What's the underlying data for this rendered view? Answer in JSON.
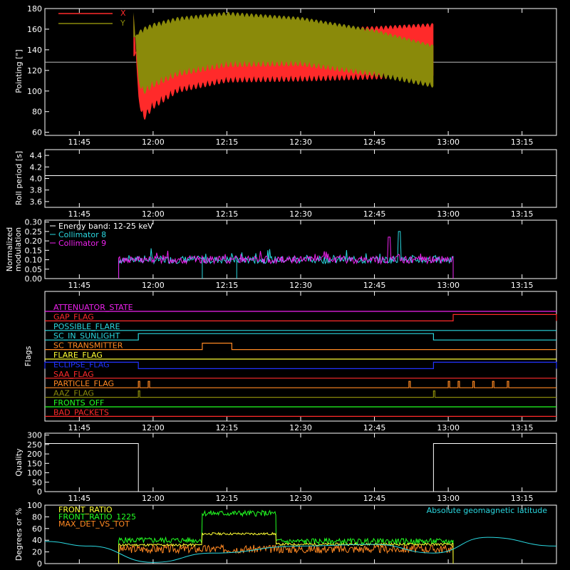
{
  "time_ticks": [
    "11:45",
    "12:00",
    "12:15",
    "12:30",
    "12:45",
    "13:00",
    "13:15"
  ],
  "colors": {
    "axis": "#ffffff",
    "red": "#ff2a2a",
    "olive": "#8a8a0a",
    "cyan": "#2ad8e0",
    "magenta": "#ee22ee",
    "yellow": "#ffff33",
    "green": "#22ff22",
    "orange": "#ff8822",
    "blue": "#2233ff"
  },
  "panels": {
    "pointing": {
      "ylabel": "Pointing [\"]",
      "yticks": [
        "180",
        "160",
        "140",
        "120",
        "100",
        "80",
        "60"
      ],
      "legend": [
        "X",
        "Y"
      ]
    },
    "roll": {
      "ylabel": "Roll period [s]",
      "yticks": [
        "4.4",
        "4.2",
        "4.0",
        "3.8",
        "3.6"
      ]
    },
    "modulation": {
      "ylabel_line1": "Normalized",
      "ylabel_line2": "modulation",
      "yticks": [
        "0.30",
        "0.25",
        "0.20",
        "0.15",
        "0.10",
        "0.05",
        "0.00"
      ],
      "legend": [
        "Energy band: 12-25 keV",
        "Collimator 8",
        "Collimator 9"
      ]
    },
    "flags": {
      "ylabel": "Flags",
      "names": [
        "ATTENUATOR_STATE",
        "GAP_FLAG",
        "POSSIBLE_FLARE",
        "SC_IN_SUNLIGHT",
        "SC_TRANSMITTER",
        "FLARE_FLAG",
        "ECLIPSE_FLAG",
        "SAA_FLAG",
        "PARTICLE_FLAG",
        "AAZ_FLAG",
        "FRONTS_OFF",
        "BAD_PACKETS"
      ]
    },
    "quality": {
      "ylabel": "Quality",
      "yticks": [
        "300",
        "250",
        "200",
        "150",
        "100",
        "50",
        "0"
      ]
    },
    "latitude": {
      "ylabel": "Degrees or %",
      "yticks": [
        "100",
        "80",
        "60",
        "40",
        "20",
        "0"
      ],
      "legend": [
        "FRONT_RATIO",
        "FRONT_RATIO_1225",
        "MAX_DET_VS_TOT"
      ],
      "legend_right": "Absolute geomagnetic latitude"
    }
  },
  "chart_data": [
    {
      "type": "line",
      "title": "",
      "ylabel": "Pointing [\"]",
      "ylim": [
        57,
        180
      ],
      "xlim": [
        "11:38",
        "13:22"
      ],
      "series": [
        {
          "name": "X",
          "x": [
            "11:56",
            "11:57",
            "11:58",
            "12:00",
            "12:05",
            "12:15",
            "12:30",
            "12:45",
            "12:57"
          ],
          "envelope_low": [
            180,
            90,
            70,
            82,
            98,
            108,
            109,
            111,
            113
          ],
          "envelope_high": [
            130,
            145,
            150,
            152,
            156,
            158,
            161,
            163,
            166
          ]
        },
        {
          "name": "Y",
          "x": [
            "11:56",
            "11:57",
            "11:58",
            "12:00",
            "12:05",
            "12:15",
            "12:30",
            "12:45",
            "12:57"
          ],
          "envelope_low": [
            180,
            108,
            96,
            103,
            114,
            123,
            124,
            114,
            103
          ],
          "envelope_high": [
            150,
            158,
            162,
            166,
            172,
            177,
            172,
            160,
            145
          ]
        }
      ],
      "reference_y": 128
    },
    {
      "type": "line",
      "ylabel": "Roll period [s]",
      "ylim": [
        3.5,
        4.5
      ],
      "series": [
        {
          "name": "",
          "x": [
            "11:38",
            "13:22"
          ],
          "y": [
            4.05,
            4.05
          ]
        }
      ]
    },
    {
      "type": "line",
      "ylabel": "Normalized modulation",
      "ylim": [
        0.0,
        0.31
      ],
      "series": [
        {
          "name": "Collimator 8",
          "x_range": [
            "11:53",
            "13:01"
          ],
          "baseline": 0.1,
          "peak": {
            "x": "12:50",
            "y": 0.25
          }
        },
        {
          "name": "Collimator 9",
          "x_range": [
            "11:53",
            "13:01"
          ],
          "baseline": 0.1,
          "peak": {
            "x": "12:48",
            "y": 0.22
          }
        }
      ],
      "annotations": [
        "Energy band: 12-25 keV"
      ]
    },
    {
      "type": "line",
      "ylabel": "Flags",
      "series": [
        {
          "name": "ATTENUATOR_STATE",
          "segments": []
        },
        {
          "name": "GAP_FLAG",
          "segments": [
            [
              "13:01",
              "13:22"
            ]
          ]
        },
        {
          "name": "POSSIBLE_FLARE",
          "segments": []
        },
        {
          "name": "SC_IN_SUNLIGHT",
          "segments": [
            [
              "11:57",
              "12:57"
            ]
          ]
        },
        {
          "name": "SC_TRANSMITTER",
          "segments": [
            [
              "12:10",
              "12:16"
            ]
          ]
        },
        {
          "name": "FLARE_FLAG",
          "segments": []
        },
        {
          "name": "ECLIPSE_FLAG",
          "segments": [
            [
              "11:38",
              "11:57"
            ],
            [
              "12:57",
              "13:22"
            ]
          ]
        },
        {
          "name": "SAA_FLAG",
          "segments": []
        },
        {
          "name": "PARTICLE_FLAG",
          "segments": [
            [
              "11:57",
              "11:57"
            ],
            [
              "11:59",
              "11:59"
            ],
            [
              "12:52",
              "12:52"
            ],
            [
              "13:00",
              "13:00"
            ],
            [
              "13:02",
              "13:02"
            ],
            [
              "13:05",
              "13:05"
            ],
            [
              "13:09",
              "13:09"
            ],
            [
              "13:12",
              "13:12"
            ]
          ]
        },
        {
          "name": "AAZ_FLAG",
          "segments": [
            [
              "11:57",
              "11:57"
            ],
            [
              "12:57",
              "12:57"
            ]
          ]
        },
        {
          "name": "FRONTS_OFF",
          "segments": []
        },
        {
          "name": "BAD_PACKETS",
          "segments": []
        }
      ]
    },
    {
      "type": "line",
      "ylabel": "Quality",
      "ylim": [
        0,
        310
      ],
      "series": [
        {
          "name": "",
          "x": [
            "11:38",
            "11:57",
            "11:57",
            "12:57",
            "12:57",
            "13:22"
          ],
          "y": [
            255,
            255,
            0,
            0,
            255,
            255
          ]
        }
      ]
    },
    {
      "type": "line",
      "ylabel": "Degrees or %",
      "ylim": [
        0,
        100
      ],
      "series": [
        {
          "name": "FRONT_RATIO",
          "x_range": [
            "11:53",
            "13:01"
          ],
          "levels": [
            [
              [
                "11:53",
                "12:10"
              ],
              32
            ],
            [
              [
                "12:10",
                "12:25"
              ],
              51
            ],
            [
              [
                "12:25",
                "13:01"
              ],
              33
            ]
          ]
        },
        {
          "name": "FRONT_RATIO_1225",
          "x_range": [
            "11:53",
            "13:01"
          ],
          "levels": [
            [
              [
                "11:53",
                "12:10"
              ],
              40
            ],
            [
              [
                "12:10",
                "12:25"
              ],
              86
            ],
            [
              [
                "12:25",
                "13:01"
              ],
              38
            ]
          ]
        },
        {
          "name": "MAX_DET_VS_TOT",
          "x_range": [
            "11:53",
            "13:01"
          ],
          "levels": [
            [
              [
                "11:53",
                "13:01"
              ],
              25
            ]
          ]
        },
        {
          "name": "Absolute geomagnetic latitude",
          "x": [
            "11:38",
            "11:47",
            "12:00",
            "12:12",
            "12:30",
            "12:45",
            "12:57",
            "13:08",
            "13:22"
          ],
          "y": [
            38,
            30,
            2,
            18,
            30,
            33,
            18,
            45,
            30
          ]
        }
      ]
    }
  ]
}
